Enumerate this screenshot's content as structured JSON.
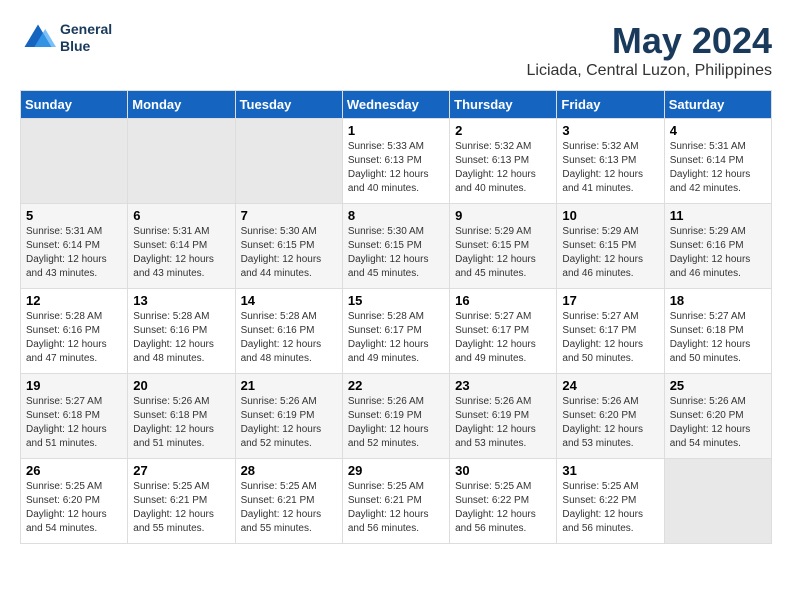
{
  "header": {
    "logo_line1": "General",
    "logo_line2": "Blue",
    "title": "May 2024",
    "subtitle": "Liciada, Central Luzon, Philippines"
  },
  "days_of_week": [
    "Sunday",
    "Monday",
    "Tuesday",
    "Wednesday",
    "Thursday",
    "Friday",
    "Saturday"
  ],
  "weeks": [
    [
      {
        "day": "",
        "info": ""
      },
      {
        "day": "",
        "info": ""
      },
      {
        "day": "",
        "info": ""
      },
      {
        "day": "1",
        "info": "Sunrise: 5:33 AM\nSunset: 6:13 PM\nDaylight: 12 hours\nand 40 minutes."
      },
      {
        "day": "2",
        "info": "Sunrise: 5:32 AM\nSunset: 6:13 PM\nDaylight: 12 hours\nand 40 minutes."
      },
      {
        "day": "3",
        "info": "Sunrise: 5:32 AM\nSunset: 6:13 PM\nDaylight: 12 hours\nand 41 minutes."
      },
      {
        "day": "4",
        "info": "Sunrise: 5:31 AM\nSunset: 6:14 PM\nDaylight: 12 hours\nand 42 minutes."
      }
    ],
    [
      {
        "day": "5",
        "info": "Sunrise: 5:31 AM\nSunset: 6:14 PM\nDaylight: 12 hours\nand 43 minutes."
      },
      {
        "day": "6",
        "info": "Sunrise: 5:31 AM\nSunset: 6:14 PM\nDaylight: 12 hours\nand 43 minutes."
      },
      {
        "day": "7",
        "info": "Sunrise: 5:30 AM\nSunset: 6:15 PM\nDaylight: 12 hours\nand 44 minutes."
      },
      {
        "day": "8",
        "info": "Sunrise: 5:30 AM\nSunset: 6:15 PM\nDaylight: 12 hours\nand 45 minutes."
      },
      {
        "day": "9",
        "info": "Sunrise: 5:29 AM\nSunset: 6:15 PM\nDaylight: 12 hours\nand 45 minutes."
      },
      {
        "day": "10",
        "info": "Sunrise: 5:29 AM\nSunset: 6:15 PM\nDaylight: 12 hours\nand 46 minutes."
      },
      {
        "day": "11",
        "info": "Sunrise: 5:29 AM\nSunset: 6:16 PM\nDaylight: 12 hours\nand 46 minutes."
      }
    ],
    [
      {
        "day": "12",
        "info": "Sunrise: 5:28 AM\nSunset: 6:16 PM\nDaylight: 12 hours\nand 47 minutes."
      },
      {
        "day": "13",
        "info": "Sunrise: 5:28 AM\nSunset: 6:16 PM\nDaylight: 12 hours\nand 48 minutes."
      },
      {
        "day": "14",
        "info": "Sunrise: 5:28 AM\nSunset: 6:16 PM\nDaylight: 12 hours\nand 48 minutes."
      },
      {
        "day": "15",
        "info": "Sunrise: 5:28 AM\nSunset: 6:17 PM\nDaylight: 12 hours\nand 49 minutes."
      },
      {
        "day": "16",
        "info": "Sunrise: 5:27 AM\nSunset: 6:17 PM\nDaylight: 12 hours\nand 49 minutes."
      },
      {
        "day": "17",
        "info": "Sunrise: 5:27 AM\nSunset: 6:17 PM\nDaylight: 12 hours\nand 50 minutes."
      },
      {
        "day": "18",
        "info": "Sunrise: 5:27 AM\nSunset: 6:18 PM\nDaylight: 12 hours\nand 50 minutes."
      }
    ],
    [
      {
        "day": "19",
        "info": "Sunrise: 5:27 AM\nSunset: 6:18 PM\nDaylight: 12 hours\nand 51 minutes."
      },
      {
        "day": "20",
        "info": "Sunrise: 5:26 AM\nSunset: 6:18 PM\nDaylight: 12 hours\nand 51 minutes."
      },
      {
        "day": "21",
        "info": "Sunrise: 5:26 AM\nSunset: 6:19 PM\nDaylight: 12 hours\nand 52 minutes."
      },
      {
        "day": "22",
        "info": "Sunrise: 5:26 AM\nSunset: 6:19 PM\nDaylight: 12 hours\nand 52 minutes."
      },
      {
        "day": "23",
        "info": "Sunrise: 5:26 AM\nSunset: 6:19 PM\nDaylight: 12 hours\nand 53 minutes."
      },
      {
        "day": "24",
        "info": "Sunrise: 5:26 AM\nSunset: 6:20 PM\nDaylight: 12 hours\nand 53 minutes."
      },
      {
        "day": "25",
        "info": "Sunrise: 5:26 AM\nSunset: 6:20 PM\nDaylight: 12 hours\nand 54 minutes."
      }
    ],
    [
      {
        "day": "26",
        "info": "Sunrise: 5:25 AM\nSunset: 6:20 PM\nDaylight: 12 hours\nand 54 minutes."
      },
      {
        "day": "27",
        "info": "Sunrise: 5:25 AM\nSunset: 6:21 PM\nDaylight: 12 hours\nand 55 minutes."
      },
      {
        "day": "28",
        "info": "Sunrise: 5:25 AM\nSunset: 6:21 PM\nDaylight: 12 hours\nand 55 minutes."
      },
      {
        "day": "29",
        "info": "Sunrise: 5:25 AM\nSunset: 6:21 PM\nDaylight: 12 hours\nand 56 minutes."
      },
      {
        "day": "30",
        "info": "Sunrise: 5:25 AM\nSunset: 6:22 PM\nDaylight: 12 hours\nand 56 minutes."
      },
      {
        "day": "31",
        "info": "Sunrise: 5:25 AM\nSunset: 6:22 PM\nDaylight: 12 hours\nand 56 minutes."
      },
      {
        "day": "",
        "info": ""
      }
    ]
  ]
}
